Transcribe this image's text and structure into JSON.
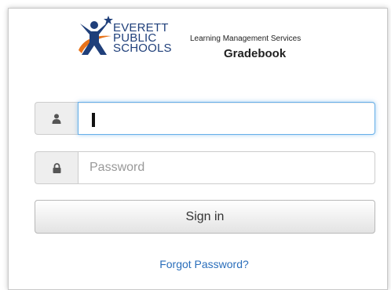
{
  "logo": {
    "line1": "EVERETT",
    "line2": "PUBLIC",
    "line3": "SCHOOLS"
  },
  "header": {
    "tagline": "Learning Management Services",
    "app_name": "Gradebook"
  },
  "form": {
    "username_value": "",
    "username_placeholder": "",
    "password_placeholder": "Password",
    "signin_label": "Sign in",
    "forgot_label": "Forgot Password?"
  },
  "icons": {
    "username": "user-icon",
    "password": "lock-icon"
  },
  "colors": {
    "brand_blue": "#1f3f7a",
    "brand_orange": "#e8731a",
    "link": "#2a6ebb",
    "focus": "#66afe9"
  }
}
